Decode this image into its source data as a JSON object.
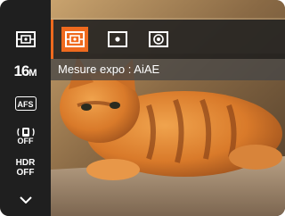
{
  "sidebar": {
    "items": [
      {
        "icon": "metering-icon"
      },
      {
        "label_main": "16",
        "label_sub": "M"
      },
      {
        "label": "AFS"
      },
      {
        "icon": "stabilizer-off-icon",
        "label": "OFF"
      },
      {
        "label_top": "HDR",
        "label_bottom": "OFF"
      },
      {
        "icon": "chevron-down-icon"
      }
    ]
  },
  "topbar": {
    "options": [
      {
        "icon": "metering-aiae-icon",
        "selected": true
      },
      {
        "icon": "metering-spot-icon",
        "selected": false
      },
      {
        "icon": "metering-center-weighted-icon",
        "selected": false
      }
    ]
  },
  "caption": {
    "text": "Mesure expo : AiAE"
  },
  "colors": {
    "accent": "#ef6a1e",
    "sidebar_bg": "#1f1f1f",
    "bar_bg": "#1e1e1e"
  }
}
